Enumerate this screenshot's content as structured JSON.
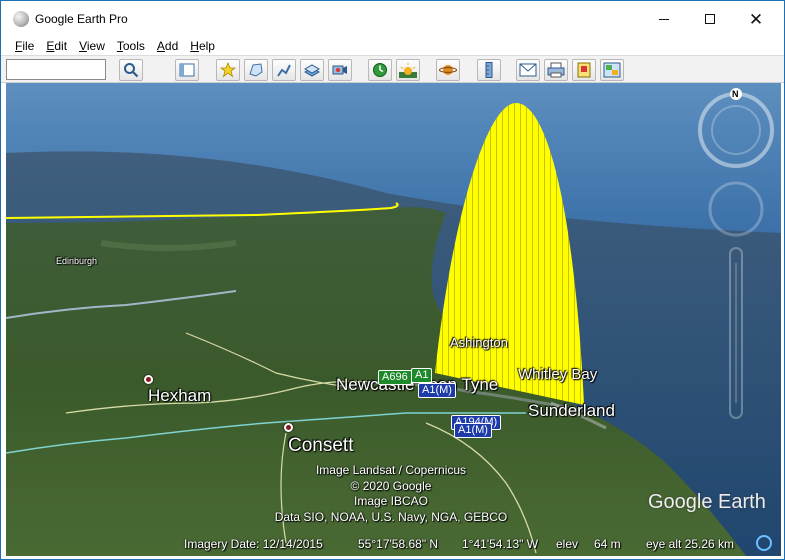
{
  "window": {
    "title": "Google Earth Pro"
  },
  "menu": [
    {
      "label": "File",
      "key": "F",
      "rest": "ile"
    },
    {
      "label": "Edit",
      "key": "E",
      "rest": "dit"
    },
    {
      "label": "View",
      "key": "V",
      "rest": "iew"
    },
    {
      "label": "Tools",
      "key": "T",
      "rest": "ools"
    },
    {
      "label": "Add",
      "key": "A",
      "rest": "dd"
    },
    {
      "label": "Help",
      "key": "H",
      "rest": "elp"
    }
  ],
  "toolbar": {
    "search_value": "",
    "buttons": [
      "search-icon",
      "sidebar-icon",
      "placemark-icon",
      "polygon-icon",
      "path-icon",
      "image-overlay-icon",
      "record-tour-icon",
      "historical-imagery-icon",
      "sunlight-icon",
      "planets-icon",
      "ruler-icon",
      "email-icon",
      "print-icon",
      "save-image-icon",
      "maps-icon"
    ]
  },
  "map": {
    "places": {
      "hexham": "Hexham",
      "consett": "Consett",
      "newcastle": "Newcastle upon Tyne",
      "sunderland": "Sunderland",
      "whitley_bay": "Whitley Bay",
      "ashington": "Ashington",
      "edinburgh_area": "Edinburgh"
    },
    "roads": {
      "a1m_1": "A1(M)",
      "a1m_2": "A1(M)",
      "a194m": "A194(M)",
      "a1": "A1",
      "a696": "A696"
    },
    "credits": [
      "Image Landsat / Copernicus",
      "© 2020 Google",
      "Image IBCAO",
      "Data SIO, NOAA, U.S. Navy, NGA, GEBCO"
    ],
    "logo": "Google Earth",
    "compass_north": "N"
  },
  "status": {
    "imagery_date": "Imagery Date: 12/14/2015",
    "lat": "55°17'58.68\" N",
    "lon": "1°41'54.13\" W",
    "elev_label": "elev",
    "elev_value": "64 m",
    "eye_alt": "eye alt  25.26 km"
  },
  "colors": {
    "beam": "#ffff00",
    "sea": "#3a5f86",
    "land": "#3b5a2a",
    "sky": "#1d5fa3"
  }
}
